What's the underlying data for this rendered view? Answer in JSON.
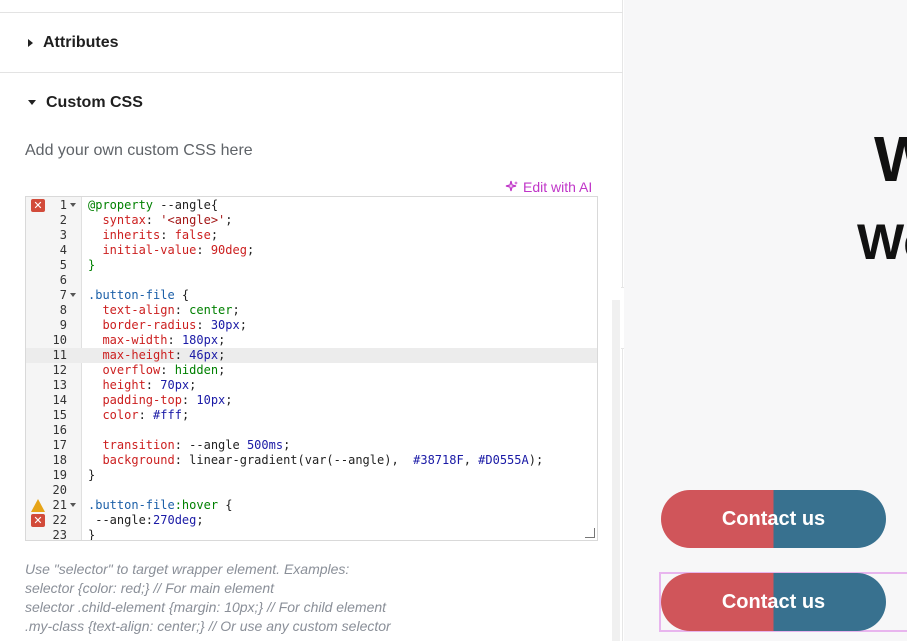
{
  "panel": {
    "attributes_title": "Attributes",
    "custom_css_title": "Custom CSS",
    "hint": "Add your own custom CSS here",
    "ai_link": "Edit with AI",
    "help_lines": [
      "Use \"selector\" to target wrapper element. Examples:",
      "selector {color: red;} // For main element",
      "selector .child-element {margin: 10px;} // For child element",
      ".my-class {text-align: center;} // Or use any custom selector"
    ]
  },
  "editor": {
    "active_line": 11,
    "lines": [
      {
        "n": "1",
        "fold": true,
        "mark": "error",
        "tokens": [
          [
            "kw",
            "@property"
          ],
          [
            "plain",
            " --angle{"
          ]
        ]
      },
      {
        "n": "2",
        "tokens": [
          [
            "prop",
            "  syntax"
          ],
          [
            "plain",
            ": "
          ],
          [
            "str",
            "'<angle>'"
          ],
          [
            "plain",
            ";"
          ]
        ]
      },
      {
        "n": "3",
        "tokens": [
          [
            "prop",
            "  inherits"
          ],
          [
            "plain",
            ": "
          ],
          [
            "prop",
            "false"
          ],
          [
            "plain",
            ";"
          ]
        ]
      },
      {
        "n": "4",
        "tokens": [
          [
            "prop",
            "  initial-value"
          ],
          [
            "plain",
            ": "
          ],
          [
            "prop",
            "90deg"
          ],
          [
            "plain",
            ";"
          ]
        ]
      },
      {
        "n": "5",
        "tokens": [
          [
            "kw",
            "}"
          ]
        ]
      },
      {
        "n": "6",
        "tokens": []
      },
      {
        "n": "7",
        "fold": true,
        "tokens": [
          [
            "sel",
            ".button-file"
          ],
          [
            "plain",
            " {"
          ]
        ]
      },
      {
        "n": "8",
        "tokens": [
          [
            "prop",
            "  text-align"
          ],
          [
            "plain",
            ": "
          ],
          [
            "val",
            "center"
          ],
          [
            "plain",
            ";"
          ]
        ]
      },
      {
        "n": "9",
        "tokens": [
          [
            "prop",
            "  border-radius"
          ],
          [
            "plain",
            ": "
          ],
          [
            "num",
            "30px"
          ],
          [
            "plain",
            ";"
          ]
        ]
      },
      {
        "n": "10",
        "tokens": [
          [
            "prop",
            "  max-width"
          ],
          [
            "plain",
            ": "
          ],
          [
            "num",
            "180px"
          ],
          [
            "plain",
            ";"
          ]
        ]
      },
      {
        "n": "11",
        "tokens": [
          [
            "prop",
            "  max-height"
          ],
          [
            "plain",
            ": "
          ],
          [
            "num",
            "46px"
          ],
          [
            "plain",
            ";"
          ]
        ]
      },
      {
        "n": "12",
        "tokens": [
          [
            "prop",
            "  overflow"
          ],
          [
            "plain",
            ": "
          ],
          [
            "val",
            "hidden"
          ],
          [
            "plain",
            ";"
          ]
        ]
      },
      {
        "n": "13",
        "tokens": [
          [
            "prop",
            "  height"
          ],
          [
            "plain",
            ": "
          ],
          [
            "num",
            "70px"
          ],
          [
            "plain",
            ";"
          ]
        ]
      },
      {
        "n": "14",
        "tokens": [
          [
            "prop",
            "  padding-top"
          ],
          [
            "plain",
            ": "
          ],
          [
            "num",
            "10px"
          ],
          [
            "plain",
            ";"
          ]
        ]
      },
      {
        "n": "15",
        "tokens": [
          [
            "prop",
            "  color"
          ],
          [
            "plain",
            ": "
          ],
          [
            "num",
            "#fff"
          ],
          [
            "plain",
            ";"
          ]
        ]
      },
      {
        "n": "16",
        "tokens": []
      },
      {
        "n": "17",
        "tokens": [
          [
            "prop",
            "  transition"
          ],
          [
            "plain",
            ": --angle "
          ],
          [
            "num",
            "500ms"
          ],
          [
            "plain",
            ";"
          ]
        ]
      },
      {
        "n": "18",
        "tokens": [
          [
            "prop",
            "  background"
          ],
          [
            "plain",
            ": linear-gradient(var(--angle),  "
          ],
          [
            "num",
            "#38718F"
          ],
          [
            "plain",
            ", "
          ],
          [
            "num",
            "#D0555A"
          ],
          [
            "plain",
            ");"
          ]
        ]
      },
      {
        "n": "19",
        "tokens": [
          [
            "plain",
            "}"
          ]
        ]
      },
      {
        "n": "20",
        "tokens": []
      },
      {
        "n": "21",
        "fold": true,
        "mark": "warning",
        "tokens": [
          [
            "sel",
            ".button-file"
          ],
          [
            "val",
            ":hover"
          ],
          [
            "plain",
            " {"
          ]
        ]
      },
      {
        "n": "22",
        "mark": "error",
        "tokens": [
          [
            "plain",
            " --angle:"
          ],
          [
            "num",
            "270deg"
          ],
          [
            "plain",
            ";"
          ]
        ]
      },
      {
        "n": "23",
        "tokens": [
          [
            "plain",
            "}"
          ]
        ]
      }
    ]
  },
  "preview": {
    "heading_1": "W",
    "heading_2": "We",
    "button_1": "Contact us",
    "button_2": "Contact us",
    "button_colors": [
      "#D0555A",
      "#38718F"
    ]
  },
  "icons": {
    "collapse": "chevron-left-icon",
    "ai": "sparkle-icon",
    "error": "error-icon",
    "warning": "warning-icon"
  }
}
